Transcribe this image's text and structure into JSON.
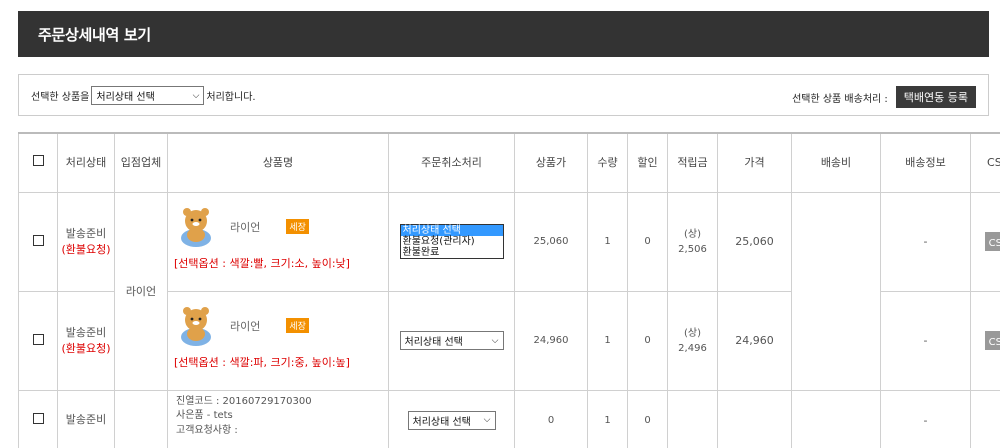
{
  "page": {
    "title": "주문상세내역 보기"
  },
  "action_bar": {
    "prefix": "선택한 상품을",
    "status_select": "처리상태 선택",
    "suffix": "처리합니다.",
    "shipping_label": "선택한 상품 배송처리 :",
    "courier_button": "택배연동 등록"
  },
  "table": {
    "headers": {
      "status": "처리상태",
      "vendor": "입점업체",
      "product": "상품명",
      "cancel": "주문취소처리",
      "unit_price": "상품가",
      "qty": "수량",
      "discount": "할인",
      "points": "적립금",
      "price": "가격",
      "shipping_fee": "배송비",
      "shipping_info": "배송정보",
      "cs": "CS관리"
    },
    "vendor_name": "라이언",
    "rows": [
      {
        "status_line1": "발송준비",
        "status_line2": "(환불요청)",
        "product_name": "라이언",
        "badge": "세장",
        "option": "[선택옵션 : 색깔:빨, 크기:소, 높이:낮]",
        "cancel_options": [
          "처리상태 선택",
          "환불요청(관리자)",
          "환불완료"
        ],
        "unit_price": "25,060",
        "qty": "1",
        "discount": "0",
        "points_label": "(상)",
        "points_value": "2,506",
        "price": "25,060",
        "shipping_info": "-",
        "cs_button": "CS관리"
      },
      {
        "status_line1": "발송준비",
        "status_line2": "(환불요청)",
        "product_name": "라이언",
        "badge": "세장",
        "option": "[선택옵션 : 색깔:파, 크기:중, 높이:높]",
        "cancel_select": "처리상태 선택",
        "unit_price": "24,960",
        "qty": "1",
        "discount": "0",
        "points_label": "(상)",
        "points_value": "2,496",
        "price": "24,960",
        "shipping_info": "-",
        "cs_button": "CS관리"
      },
      {
        "status_line1": "발송준비",
        "gift_line1": "진열코드 : 20160729170300",
        "gift_line2": "사은품 - tets",
        "gift_line3": "고객요청사항 :",
        "cancel_select": "처리상태 선택",
        "unit_price": "0",
        "qty": "1",
        "discount": "0",
        "shipping_info": "-"
      }
    ]
  }
}
